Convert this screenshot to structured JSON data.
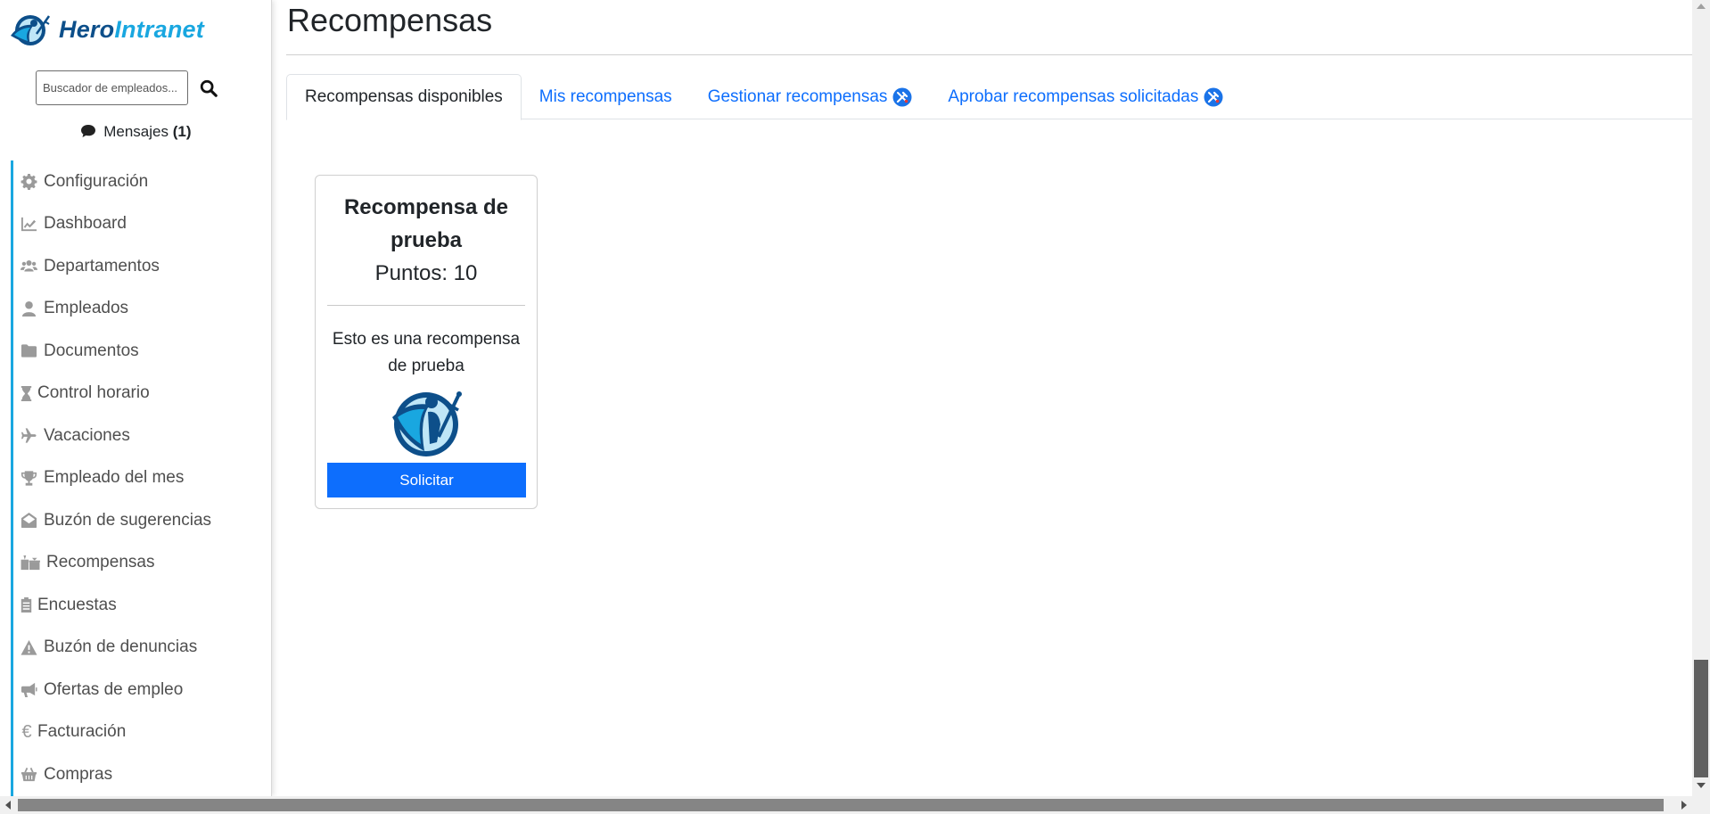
{
  "brand": {
    "name_part1": "Hero",
    "name_part2": "Intranet",
    "color_primary": "#0d4f8a",
    "color_accent": "#19a7e0"
  },
  "sidebar": {
    "search": {
      "placeholder": "Buscador de empleados...",
      "value": ""
    },
    "messages": {
      "label": "Mensajes",
      "count": "(1)",
      "icon": "comment-icon"
    },
    "items": [
      {
        "label": "Configuración",
        "icon": "gear-icon"
      },
      {
        "label": "Dashboard",
        "icon": "chart-line-icon"
      },
      {
        "label": "Departamentos",
        "icon": "users-icon"
      },
      {
        "label": "Empleados",
        "icon": "user-icon"
      },
      {
        "label": "Documentos",
        "icon": "folder-icon"
      },
      {
        "label": "Control horario",
        "icon": "hourglass-icon"
      },
      {
        "label": "Vacaciones",
        "icon": "plane-icon"
      },
      {
        "label": "Empleado del mes",
        "icon": "trophy-icon"
      },
      {
        "label": "Buzón de sugerencias",
        "icon": "envelope-open-icon"
      },
      {
        "label": "Recompensas",
        "icon": "gifts-icon"
      },
      {
        "label": "Encuestas",
        "icon": "clipboard-list-icon"
      },
      {
        "label": "Buzón de denuncias",
        "icon": "warning-icon"
      },
      {
        "label": "Ofertas de empleo",
        "icon": "bullhorn-icon"
      },
      {
        "label": "Facturación",
        "icon": "euro-icon"
      },
      {
        "label": "Compras",
        "icon": "basket-icon"
      }
    ]
  },
  "main": {
    "title": "Recompensas",
    "tabs": [
      {
        "label": "Recompensas disponibles",
        "active": true
      },
      {
        "label": "Mis recompensas",
        "active": false
      },
      {
        "label": "Gestionar recompensas",
        "active": false,
        "admin_icon": "admin-tools-icon"
      },
      {
        "label": "Aprobar recompensas solicitadas",
        "active": false,
        "admin_icon": "admin-tools-icon"
      }
    ],
    "rewards": [
      {
        "title": "Recompensa de prueba",
        "points": "Puntos: 10",
        "description": "Esto es una recompensa de prueba",
        "image_icon": "hero-logo-icon",
        "button_label": "Solicitar"
      }
    ]
  },
  "colors": {
    "primary_button": "#0d6efd",
    "link": "#0d6efd"
  }
}
